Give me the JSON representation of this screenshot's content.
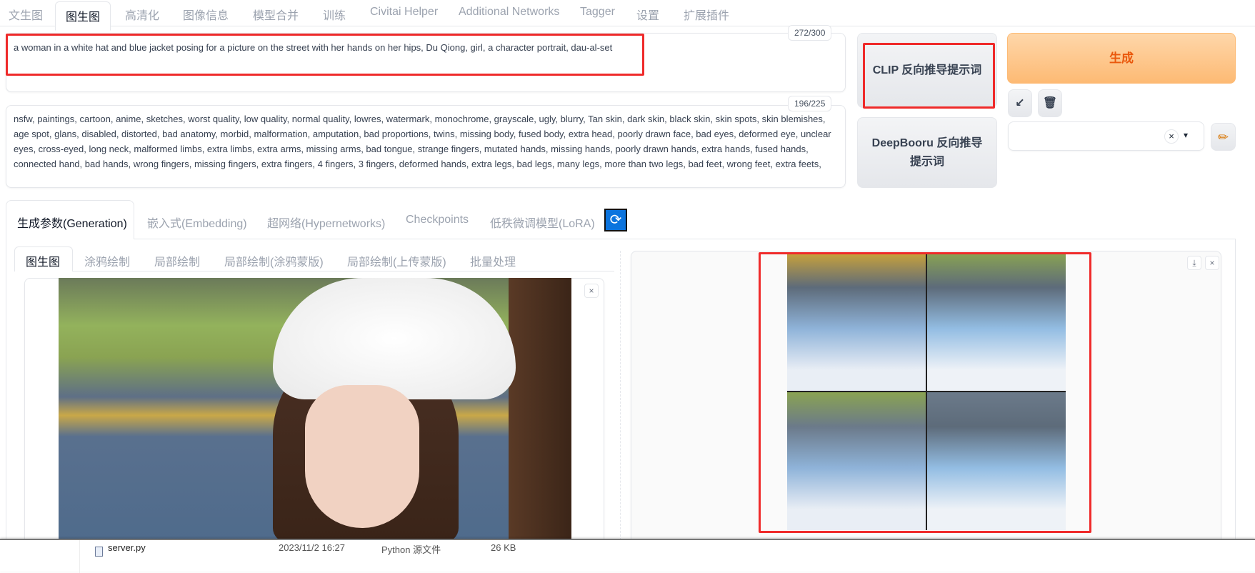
{
  "top_tabs": [
    "文生图",
    "图生图",
    "高清化",
    "图像信息",
    "模型合并",
    "训练",
    "Civitai Helper",
    "Additional Networks",
    "Tagger",
    "设置",
    "扩展插件"
  ],
  "active_top_tab": "图生图",
  "prompt": {
    "value": "a woman in a white hat and blue jacket posing for a picture on the street with her hands on her hips, Du Qiong, girl, a character portrait, dau-al-set",
    "counter": "272/300"
  },
  "negative_prompt": {
    "value": "nsfw, paintings, cartoon, anime, sketches, worst quality, low quality, normal quality, lowres, watermark, monochrome, grayscale, ugly, blurry, Tan skin, dark skin, black skin, skin spots, skin blemishes, age spot, glans, disabled, distorted, bad anatomy, morbid, malformation, amputation, bad proportions, twins, missing body, fused body, extra head, poorly drawn face, bad eyes, deformed eye, unclear eyes, cross-eyed, long neck, malformed limbs, extra limbs, extra arms, missing arms, bad tongue, strange fingers, mutated hands, missing hands, poorly drawn hands, extra hands, fused hands, connected hand, bad hands, wrong fingers, missing fingers, extra fingers, 4 fingers, 3 fingers, deformed hands, extra legs, bad legs, many legs, more than two legs, bad feet, wrong feet, extra feets,",
    "counter": "196/225"
  },
  "buttons": {
    "clip": "CLIP 反向推导提示词",
    "deepbooru": "DeepBooru 反向推导提示词",
    "generate": "生成",
    "arrow": "↙",
    "trash": "🗑",
    "pencil": "✏",
    "clear": "×",
    "dropdown": "▾"
  },
  "colors": {
    "generate_bg": "#fdba74",
    "generate_text": "#ea580c",
    "highlight": "#ef2a2a",
    "refresh": "#0b74de"
  },
  "param_tabs": [
    "生成参数(Generation)",
    "嵌入式(Embedding)",
    "超网络(Hypernetworks)",
    "Checkpoints",
    "低秩微调模型(LoRA)"
  ],
  "sub_tabs": [
    "图生图",
    "涂鸦绘制",
    "局部绘制",
    "局部绘制(涂鸦蒙版)",
    "局部绘制(上传蒙版)",
    "批量处理"
  ],
  "close": "×",
  "download": "⤓",
  "file_row": {
    "name": "server.py",
    "date": "2023/11/2 16:27",
    "type": "Python 源文件",
    "size": "26 KB"
  }
}
